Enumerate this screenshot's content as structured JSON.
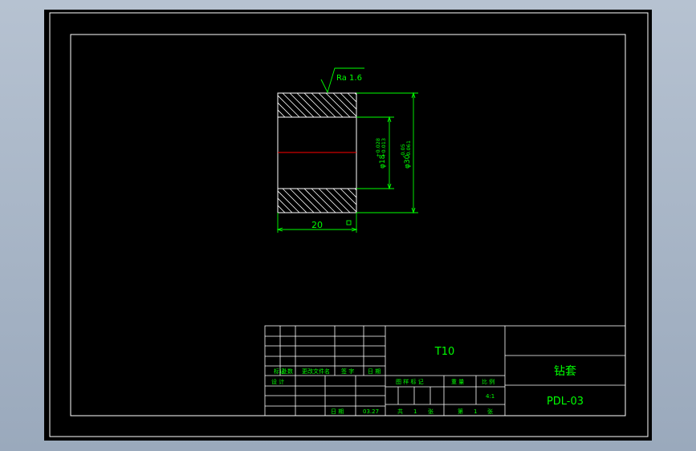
{
  "drawing": {
    "roughness_label": "Ra 1.6",
    "dim_length": "20",
    "dim_inner_dia": "φ18",
    "dim_inner_tol_upper": "+0.028",
    "dim_inner_tol_lower": "+0.013",
    "dim_outer_dia": "φ30",
    "dim_outer_tol_upper": "-0.05",
    "dim_outer_tol_lower": "-0.061"
  },
  "title_block": {
    "material": "T10",
    "part_name": "钻套",
    "drawing_no": "PDL-03",
    "scale": "4:1",
    "rev_headers": [
      "标记",
      "处数",
      "更改文件名",
      "签 字",
      "日 期"
    ],
    "design_label": "设 计",
    "date_label": "日 期",
    "date_value": "03.27",
    "stage_label": "图 样 标 记",
    "weight_label": "重 量",
    "scale_label": "比 例",
    "total_label": "共",
    "total_count": "1",
    "sheet_unit": "张",
    "sheet_label": "第",
    "sheet_no": "1",
    "sheet_unit2": "张"
  },
  "colors": {
    "background": "#000000",
    "frame": "#ffffff",
    "dimension": "#00ff00",
    "centerline": "#ff0000",
    "title_text": "#00ff00",
    "hatch": "#ffffff"
  }
}
